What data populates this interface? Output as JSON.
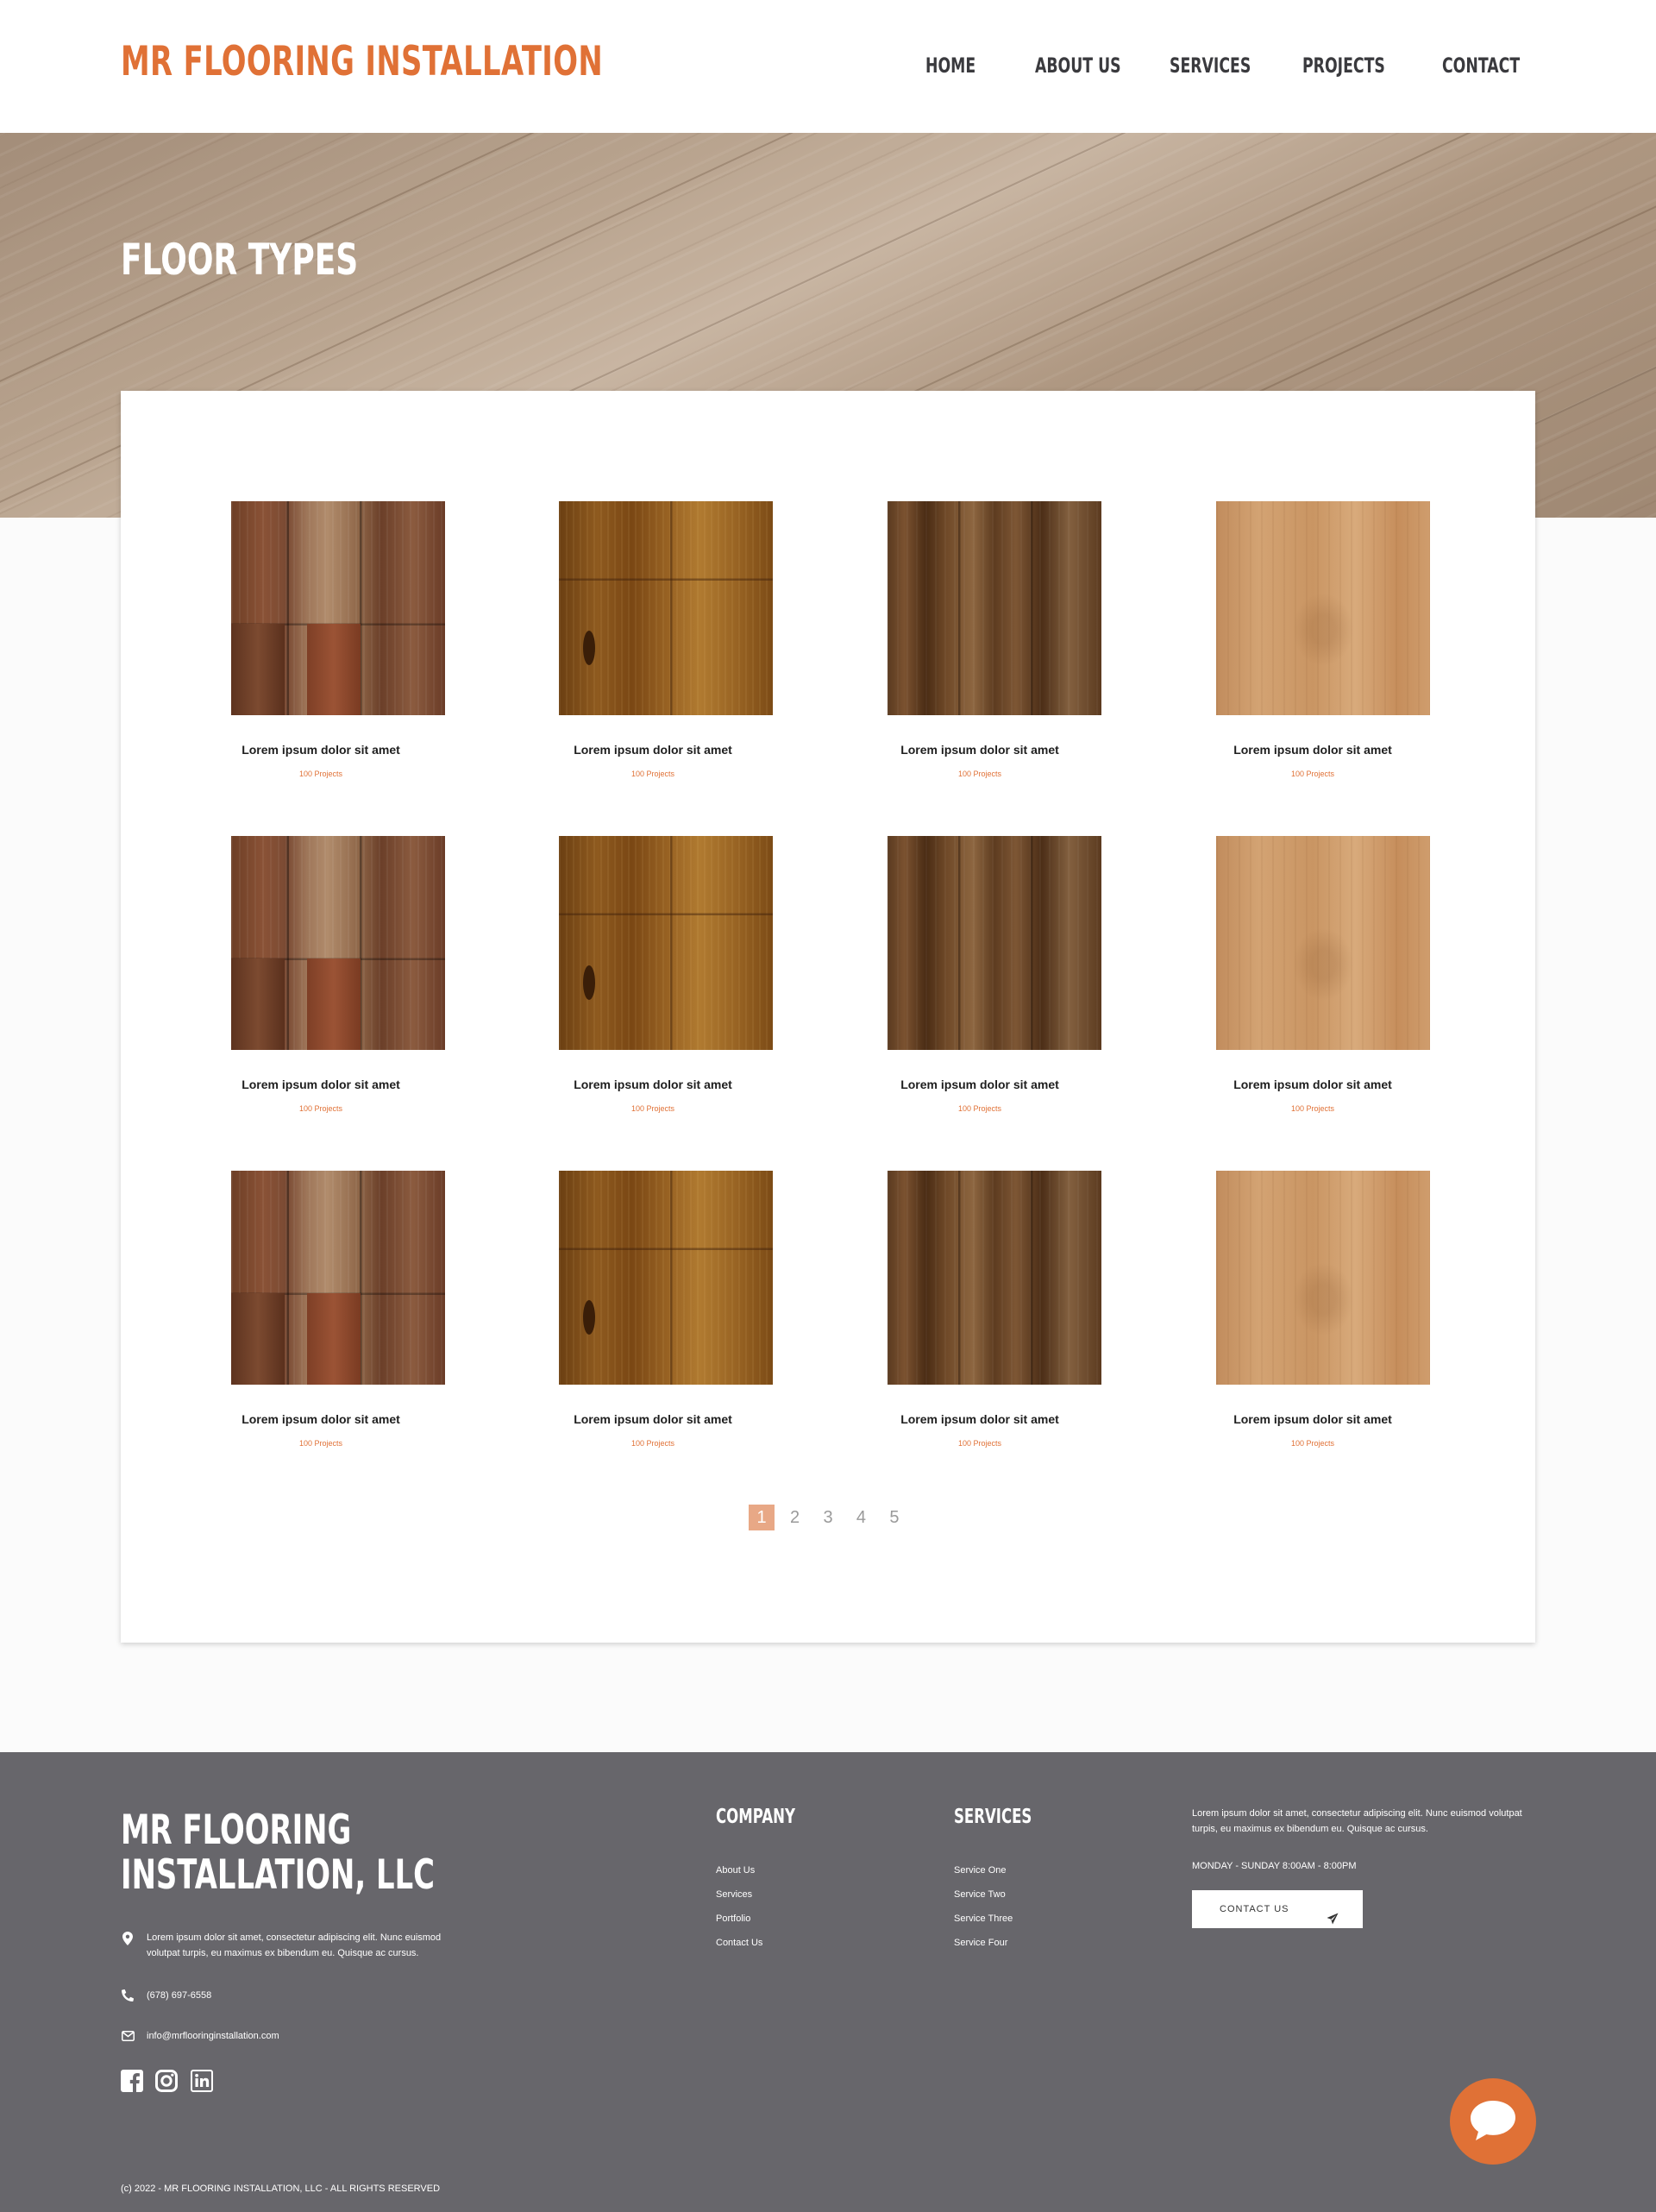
{
  "header": {
    "logo": "MR FLOORING INSTALLATION",
    "nav": [
      "HOME",
      "ABOUT US",
      "SERVICES",
      "PROJECTS",
      "CONTACT"
    ]
  },
  "hero": {
    "title": "FLOOR TYPES"
  },
  "grid": {
    "items": [
      {
        "title": "Lorem ipsum dolor sit amet",
        "sub": "100 Projects",
        "wood": "walnut-plank"
      },
      {
        "title": "Lorem ipsum dolor sit amet",
        "sub": "100 Projects",
        "wood": "hickory-amber"
      },
      {
        "title": "Lorem ipsum dolor sit amet",
        "sub": "100 Projects",
        "wood": "dark-walnut"
      },
      {
        "title": "Lorem ipsum dolor sit amet",
        "sub": "100 Projects",
        "wood": "light-maple"
      },
      {
        "title": "Lorem ipsum dolor sit amet",
        "sub": "100 Projects",
        "wood": "walnut-plank"
      },
      {
        "title": "Lorem ipsum dolor sit amet",
        "sub": "100 Projects",
        "wood": "hickory-amber"
      },
      {
        "title": "Lorem ipsum dolor sit amet",
        "sub": "100 Projects",
        "wood": "dark-walnut"
      },
      {
        "title": "Lorem ipsum dolor sit amet",
        "sub": "100 Projects",
        "wood": "light-maple"
      },
      {
        "title": "Lorem ipsum dolor sit amet",
        "sub": "100 Projects",
        "wood": "walnut-plank"
      },
      {
        "title": "Lorem ipsum dolor sit amet",
        "sub": "100 Projects",
        "wood": "hickory-amber"
      },
      {
        "title": "Lorem ipsum dolor sit amet",
        "sub": "100 Projects",
        "wood": "dark-walnut"
      },
      {
        "title": "Lorem ipsum dolor sit amet",
        "sub": "100 Projects",
        "wood": "light-maple"
      }
    ]
  },
  "pagination": {
    "pages": [
      "1",
      "2",
      "3",
      "4",
      "5"
    ],
    "active": "1"
  },
  "footer": {
    "brand_line1": "MR FLOORING",
    "brand_line2": "INSTALLATION, LLC",
    "address": "Lorem ipsum dolor sit amet, consectetur adipiscing elit. Nunc euismod volutpat turpis, eu maximus ex bibendum eu. Quisque ac cursus.",
    "phone": "(678) 697-6558",
    "email": "info@mrflooringinstallation.com",
    "company_heading": "COMPANY",
    "company_links": [
      "About Us",
      "Services",
      "Portfolio",
      "Contact Us"
    ],
    "services_heading": "SERVICES",
    "services_links": [
      "Service One",
      "Service Two",
      "Service Three",
      "Service Four"
    ],
    "about": "Lorem ipsum dolor sit amet, consectetur adipiscing elit. Nunc euismod volutpat turpis, eu maximus ex bibendum eu. Quisque ac cursus.",
    "hours": "MONDAY - SUNDAY 8:00AM - 8:00PM",
    "contact_button": "CONTACT US",
    "copyright": "(c) 2022 - MR FLOORING INSTALLATION, LLC - ALL RIGHTS RESERVED",
    "social": [
      "facebook-icon",
      "instagram-icon",
      "linkedin-icon"
    ]
  },
  "colors": {
    "accent": "#e07136",
    "footer_bg": "#67666b",
    "page_active": "#e8a886",
    "nav_text": "#3a3a3e"
  }
}
